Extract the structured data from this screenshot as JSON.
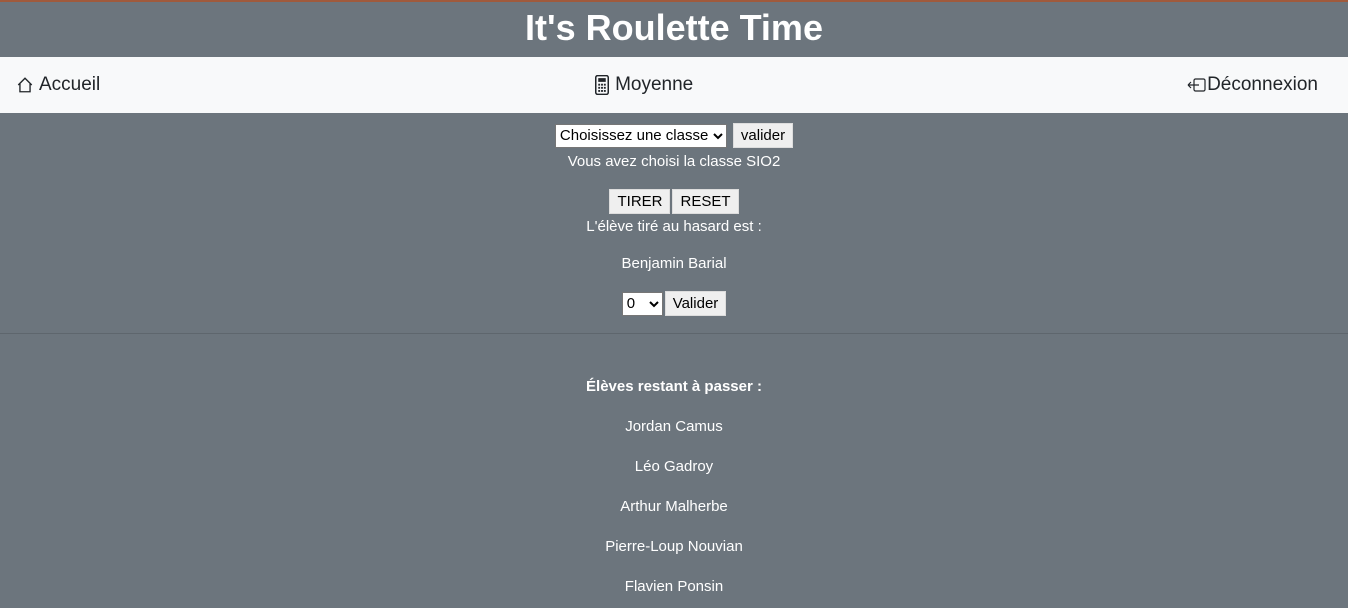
{
  "header": {
    "title": "It's Roulette Time"
  },
  "nav": {
    "home": "Accueil",
    "average": "Moyenne",
    "logout": "Déconnexion",
    "home_icon": "house-icon",
    "average_icon": "calculator-icon",
    "logout_icon": "logout-icon"
  },
  "class_select": {
    "value": "Choisissez une classe",
    "submit": "valider",
    "chosen_text": "Vous avez choisi la classe SIO2"
  },
  "draw": {
    "draw_button": "TIRER",
    "reset_button": "RESET",
    "label": "L'élève tiré au hasard est :",
    "student": "Benjamin Barial",
    "grade_value": "0",
    "grade_submit": "Valider"
  },
  "remaining": {
    "heading": "Élèves restant à passer :",
    "students": [
      "Jordan Camus",
      "Léo Gadroy",
      "Arthur Malherbe",
      "Pierre-Loup Nouvian",
      "Flavien Ponsin"
    ]
  },
  "colors": {
    "background": "#6c757d",
    "navbar": "#f8f9fa",
    "top_border": "#a05a3c"
  }
}
